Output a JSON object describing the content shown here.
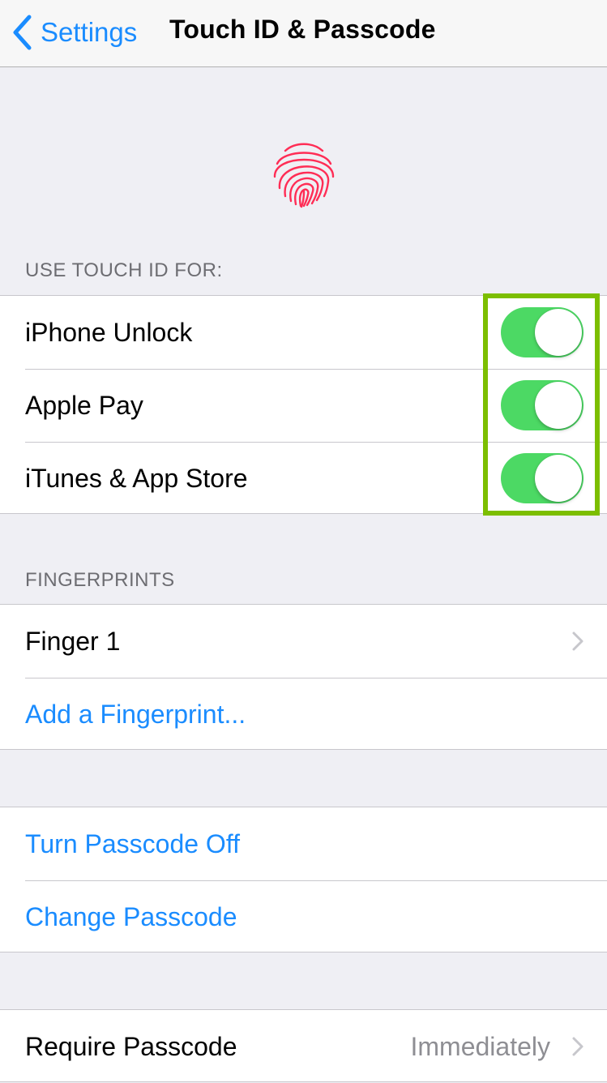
{
  "navbar": {
    "back_label": "Settings",
    "title": "Touch ID & Passcode"
  },
  "colors": {
    "accent": "#1a8cff",
    "toggle_on": "#4cd964",
    "fingerprint": "#ff2d55",
    "highlight_box": "#7cbe00"
  },
  "touch_id": {
    "header": "USE TOUCH ID FOR:",
    "rows": [
      {
        "label": "iPhone Unlock",
        "on": true
      },
      {
        "label": "Apple Pay",
        "on": true
      },
      {
        "label": "iTunes & App Store",
        "on": true
      }
    ]
  },
  "fingerprints": {
    "header": "FINGERPRINTS",
    "finger1": "Finger 1",
    "add": "Add a Fingerprint..."
  },
  "passcode": {
    "turn_off": "Turn Passcode Off",
    "change": "Change Passcode"
  },
  "require": {
    "label": "Require Passcode",
    "value": "Immediately"
  },
  "icons": {
    "back": "chevron-left-icon",
    "fingerprint": "fingerprint-icon",
    "disclosure": "chevron-right-icon"
  }
}
